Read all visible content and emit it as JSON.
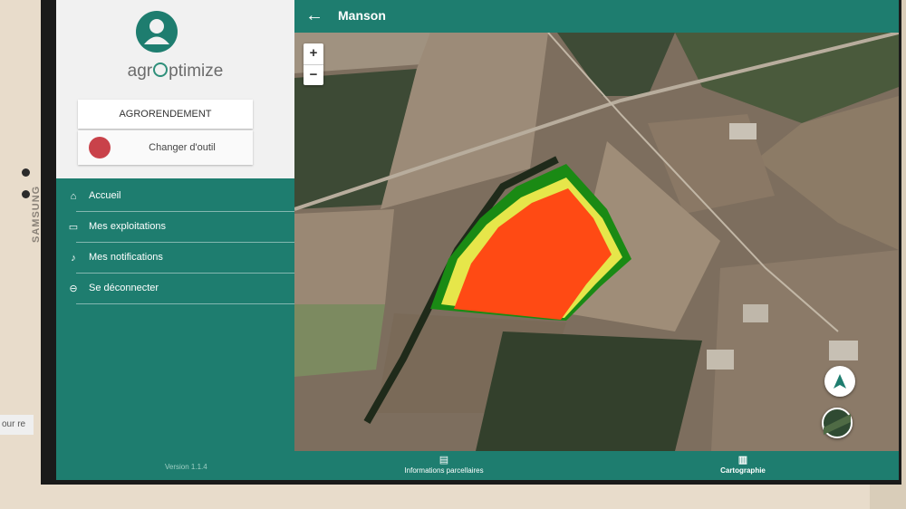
{
  "device": {
    "brand": "SAMSUNG"
  },
  "sidebar": {
    "app_name_prefix": "agr",
    "app_name_suffix": "ptimize",
    "module_label": "AGRORENDEMENT",
    "switch_tool_label": "Changer d'outil",
    "items": [
      {
        "label": "Accueil",
        "icon": "home-icon"
      },
      {
        "label": "Mes exploitations",
        "icon": "folder-icon"
      },
      {
        "label": "Mes notifications",
        "icon": "bell-icon"
      },
      {
        "label": "Se déconnecter",
        "icon": "logout-icon"
      }
    ],
    "version": "Version 1.1.4"
  },
  "header": {
    "title": "Manson"
  },
  "map": {
    "zoom_in": "+",
    "zoom_out": "−",
    "zone_colors": {
      "low": "#1a8a14",
      "medium": "#e6e64a",
      "high": "#ff4a14"
    }
  },
  "bottom_nav": {
    "tabs": [
      {
        "label": "Informations parcellaires",
        "icon": "document-icon"
      },
      {
        "label": "Cartographie",
        "icon": "map-icon"
      }
    ]
  },
  "background_window": {
    "text": "our re"
  },
  "colors": {
    "primary": "#1e7d6f"
  }
}
